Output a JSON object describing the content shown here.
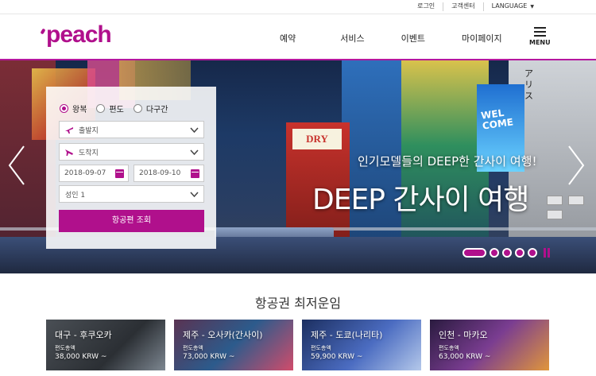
{
  "util": {
    "login": "로그인",
    "support": "고객센터",
    "language": "LANGUAGE"
  },
  "header": {
    "logo": "peach",
    "nav": [
      "예약",
      "서비스",
      "이벤트",
      "마이페이지"
    ],
    "menu_label": "MENU"
  },
  "hero": {
    "subtitle": "인기모델들의 DEEP한 간사이 여행!",
    "title": "DEEP 간사이 여행",
    "signage": {
      "dry": "DRY",
      "welcome": "WEL COME",
      "vertical": "アリス"
    }
  },
  "booking": {
    "trip_types": [
      {
        "label": "왕복",
        "selected": true
      },
      {
        "label": "편도",
        "selected": false
      },
      {
        "label": "다구간",
        "selected": false
      }
    ],
    "departure_placeholder": "출발지",
    "arrival_placeholder": "도착지",
    "depart_date": "2018-09-07",
    "return_date": "2018-09-10",
    "passengers": "성인 1",
    "search_label": "항공편 조회"
  },
  "fares": {
    "title": "항공권 최저운임",
    "cards": [
      {
        "route": "대구 - 후쿠오카",
        "trip_type": "편도총액",
        "price": "38,000 KRW ~"
      },
      {
        "route": "제주 - 오사카(간사이)",
        "trip_type": "편도총액",
        "price": "73,000 KRW ~"
      },
      {
        "route": "제주 - 도쿄(나리타)",
        "trip_type": "편도총액",
        "price": "59,900 KRW ~"
      },
      {
        "route": "인천 - 마카오",
        "trip_type": "편도총액",
        "price": "63,000 KRW ~"
      }
    ]
  },
  "colors": {
    "brand": "#b0108c"
  }
}
